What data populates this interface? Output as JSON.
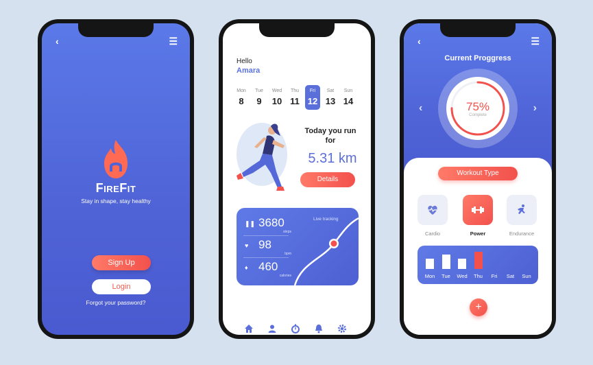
{
  "screen1": {
    "back_icon": "‹",
    "menu_icon": "☰",
    "brand": "FireFit",
    "tagline": "Stay in shape, stay healthy",
    "signup_label": "Sign Up",
    "login_label": "Login",
    "forgot_label": "Forgot your password?"
  },
  "screen2": {
    "greeting": "Hello",
    "name": "Amara",
    "days": [
      {
        "name": "Mon",
        "date": "8"
      },
      {
        "name": "Tue",
        "date": "9"
      },
      {
        "name": "Wed",
        "date": "10"
      },
      {
        "name": "Thu",
        "date": "11"
      },
      {
        "name": "Fri",
        "date": "12"
      },
      {
        "name": "Sat",
        "date": "13"
      },
      {
        "name": "Sun",
        "date": "14"
      }
    ],
    "selected_day": "Fri",
    "run_heading": "Today you run for",
    "distance": "5.31 km",
    "details_label": "Details",
    "live_label": "Live tracking",
    "stats": [
      {
        "icon": "footsteps-icon",
        "value": "3680",
        "unit": "steps"
      },
      {
        "icon": "heart-icon",
        "value": "98",
        "unit": "bpm"
      },
      {
        "icon": "flame-icon",
        "value": "460",
        "unit": "calories"
      }
    ]
  },
  "screen3": {
    "title": "Current Proggress",
    "progress_value": "75%",
    "progress_fraction": 0.75,
    "progress_label": "Complete",
    "workout_label": "Workout Type",
    "workout_types": [
      {
        "label": "Cardio",
        "icon": "heart-pulse-icon"
      },
      {
        "label": "Power",
        "icon": "dumbbell-icon"
      },
      {
        "label": "Endurance",
        "icon": "runner-icon"
      }
    ],
    "selected_workout": "Power",
    "week_days": [
      "Mon",
      "Tue",
      "Wed",
      "Thu",
      "Fri",
      "Sat",
      "Sun"
    ],
    "week_levels": [
      0.55,
      0.75,
      0.55,
      0.9,
      0,
      0,
      0
    ],
    "highlighted_day": "Thu"
  },
  "colors": {
    "primary": "#5b6fdb",
    "accent": "#f2514c",
    "background": "#d5e1ef"
  }
}
